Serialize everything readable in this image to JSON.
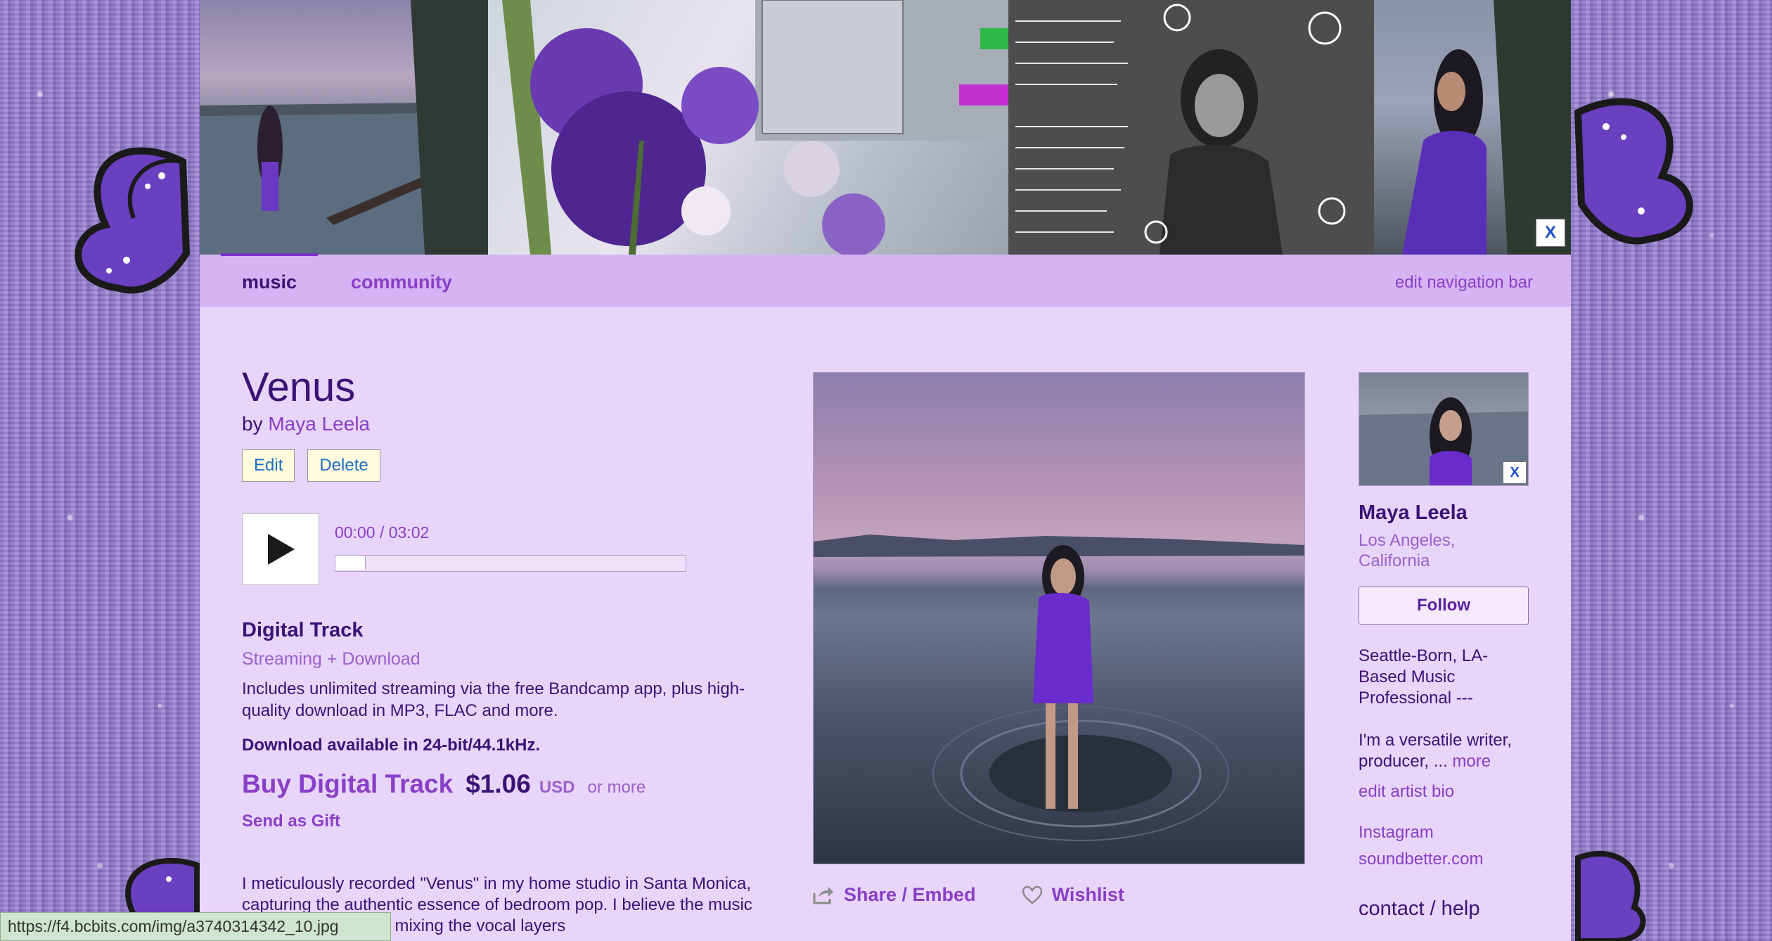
{
  "banner": {
    "close_label": "X"
  },
  "nav": {
    "music_label": "music",
    "community_label": "community",
    "edit_label": "edit navigation bar"
  },
  "track": {
    "title": "Venus",
    "by_prefix": "by",
    "artist": "Maya Leela",
    "edit_label": "Edit",
    "delete_label": "Delete"
  },
  "player": {
    "time": "00:00 / 03:02",
    "progress_fraction": 0
  },
  "purchase": {
    "heading": "Digital Track",
    "subheading": "Streaming + Download",
    "description": "Includes unlimited streaming via the free Bandcamp app, plus high-quality download in MP3, FLAC and more.",
    "bitrate": "Download available in 24-bit/44.1kHz.",
    "buy_label": "Buy Digital Track",
    "price": "$1.06",
    "currency": "USD",
    "or_more": "or more",
    "gift_label": "Send as Gift"
  },
  "about": {
    "text": "I meticulously recorded \"Venus\" in my home studio in Santa Monica, capturing the authentic essence of bedroom pop. I believe the music is a good ear. While mixing the vocal layers"
  },
  "art_actions": {
    "share_label": "Share / Embed",
    "wishlist_label": "Wishlist"
  },
  "artist_panel": {
    "photo_close_label": "X",
    "name": "Maya Leela",
    "location": "Los Angeles, California",
    "follow_label": "Follow",
    "bio_line1": "Seattle-Born, LA-Based Music Professional ---",
    "bio_line2": "I'm a versatile writer, producer, ...",
    "bio_more": "more",
    "edit_bio_label": "edit artist bio",
    "instagram_label": "Instagram",
    "soundbetter_label": "soundbetter.com",
    "contact_label": "contact / help"
  },
  "status_bar": {
    "url": "https://f4.bcbits.com/img/a3740314342_10.jpg"
  },
  "colors": {
    "page_bg": "#e8d5fa",
    "nav_bg": "#d6b4f4",
    "link": "#8a3fc7",
    "text": "#3b1275",
    "secondary": "#9b61cc"
  }
}
